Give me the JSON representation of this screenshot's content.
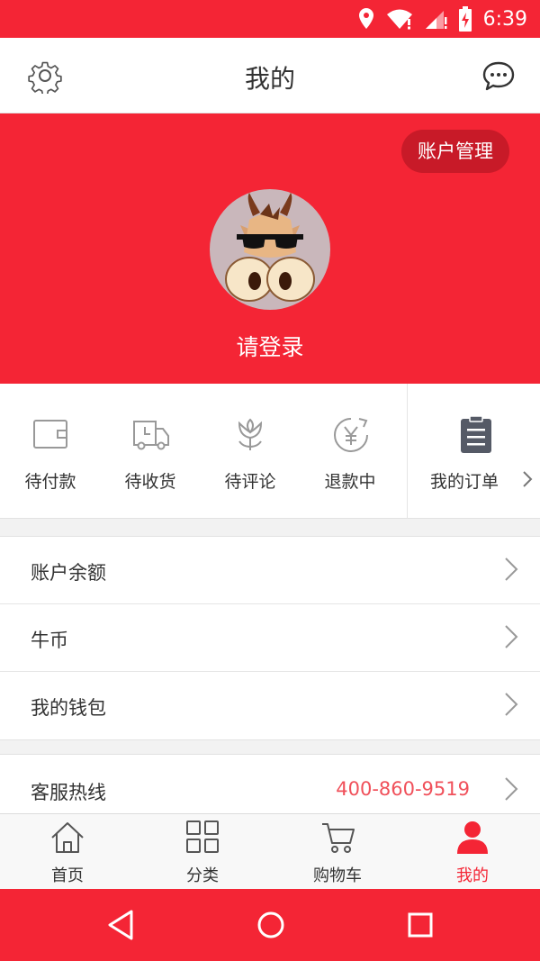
{
  "statusbar": {
    "time": "6:39",
    "icons": [
      "location-icon",
      "wifi-icon",
      "signal-icon",
      "battery-charging-icon"
    ]
  },
  "header": {
    "title": "我的",
    "left_icon": "gear-icon",
    "right_icon": "chat-icon"
  },
  "profile": {
    "account_button": "账户管理",
    "login_text": "请登录",
    "avatar": "goat-with-sunglasses-avatar"
  },
  "orders": {
    "items": [
      {
        "label": "待付款",
        "icon": "wallet-icon"
      },
      {
        "label": "待收货",
        "icon": "delivery-truck-icon"
      },
      {
        "label": "待评论",
        "icon": "tulip-icon"
      },
      {
        "label": "退款中",
        "icon": "refund-yen-icon"
      }
    ],
    "my_orders": {
      "label": "我的订单",
      "icon": "clipboard-icon"
    }
  },
  "menu_group1": [
    {
      "label": "账户余额"
    },
    {
      "label": "牛币"
    },
    {
      "label": "我的钱包"
    }
  ],
  "menu_group2": [
    {
      "label": "客服热线",
      "value": "400-860-9519"
    }
  ],
  "tabbar": {
    "tabs": [
      {
        "label": "首页",
        "icon": "home-icon"
      },
      {
        "label": "分类",
        "icon": "grid-icon"
      },
      {
        "label": "购物车",
        "icon": "cart-icon"
      },
      {
        "label": "我的",
        "icon": "person-icon",
        "active": true
      }
    ]
  },
  "colors": {
    "primary": "#f42535",
    "accent_text": "#f0505a",
    "account_button_bg": "#c81a28"
  }
}
